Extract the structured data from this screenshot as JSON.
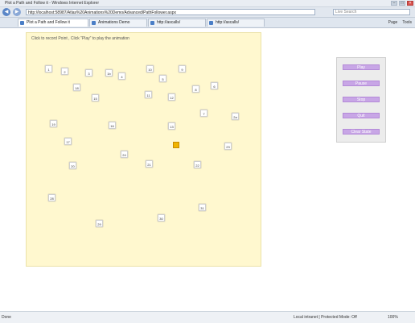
{
  "window": {
    "title": "Plot a Path and Follow it - Windows Internet Explorer"
  },
  "address": {
    "url": "http://localhost:58987/Atlas%20Animations%20Demo/Advanced/PathFollower.aspx",
    "search_placeholder": "Live Search"
  },
  "tabs": [
    {
      "label": "Plot a Path and Follow it",
      "active": true
    },
    {
      "label": "Animations Demo",
      "active": false
    },
    {
      "label": "http://ascalls/",
      "active": false
    },
    {
      "label": "http://ascalls/",
      "active": false
    }
  ],
  "toolbar": {
    "page": "Page",
    "tools": "Tools"
  },
  "canvas": {
    "instruction": "Click to record Point , Click \"Play\" to play the animation",
    "points": [
      "1",
      "2",
      "3",
      "1b",
      "4",
      "10",
      "9",
      "5",
      "8",
      "6",
      "18",
      "11",
      "12",
      "15",
      "7",
      "2a",
      "19",
      "16",
      "13",
      "17",
      "24",
      "23",
      "20",
      "21",
      "22",
      "28",
      "31",
      "30",
      "29"
    ]
  },
  "panel": {
    "buttons": [
      "Play",
      "Pause",
      "Stop",
      "Quit",
      "Clear State"
    ]
  },
  "status": {
    "left": "Done",
    "zone": "Local intranet | Protected Mode: Off",
    "zoom": "100%"
  }
}
